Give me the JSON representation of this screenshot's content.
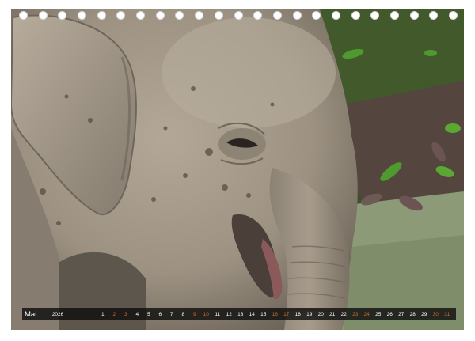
{
  "calendar": {
    "month": "Mai",
    "year": "2026",
    "days": [
      {
        "label": "1",
        "weekend": false
      },
      {
        "label": "2",
        "weekend": true
      },
      {
        "label": "3",
        "weekend": true
      },
      {
        "label": "4",
        "weekend": false
      },
      {
        "label": "5",
        "weekend": false
      },
      {
        "label": "6",
        "weekend": false
      },
      {
        "label": "7",
        "weekend": false
      },
      {
        "label": "8",
        "weekend": false
      },
      {
        "label": "9",
        "weekend": true
      },
      {
        "label": "10",
        "weekend": true
      },
      {
        "label": "11",
        "weekend": false
      },
      {
        "label": "12",
        "weekend": false
      },
      {
        "label": "13",
        "weekend": false
      },
      {
        "label": "14",
        "weekend": false
      },
      {
        "label": "15",
        "weekend": false
      },
      {
        "label": "16",
        "weekend": true
      },
      {
        "label": "17",
        "weekend": true
      },
      {
        "label": "18",
        "weekend": false
      },
      {
        "label": "19",
        "weekend": false
      },
      {
        "label": "20",
        "weekend": false
      },
      {
        "label": "21",
        "weekend": false
      },
      {
        "label": "22",
        "weekend": false
      },
      {
        "label": "23",
        "weekend": true
      },
      {
        "label": "24",
        "weekend": true
      },
      {
        "label": "25",
        "weekend": false
      },
      {
        "label": "26",
        "weekend": false
      },
      {
        "label": "27",
        "weekend": false
      },
      {
        "label": "28",
        "weekend": false
      },
      {
        "label": "29",
        "weekend": false
      },
      {
        "label": "30",
        "weekend": true
      },
      {
        "label": "31",
        "weekend": true
      }
    ],
    "weekend_color": "#d86a2a",
    "strip_color": "#111111"
  },
  "binding": {
    "ring_count": 23,
    "ring_color": "#ffffff"
  },
  "photo": {
    "subject_icon": "elephant-photo",
    "palette": {
      "skin": "#a89d8d",
      "skin_shadow": "#6e665b",
      "foliage": "#3f5a2a",
      "leaf_litter": "#5a4a44",
      "leaf_green": "#4f9a2f"
    }
  }
}
